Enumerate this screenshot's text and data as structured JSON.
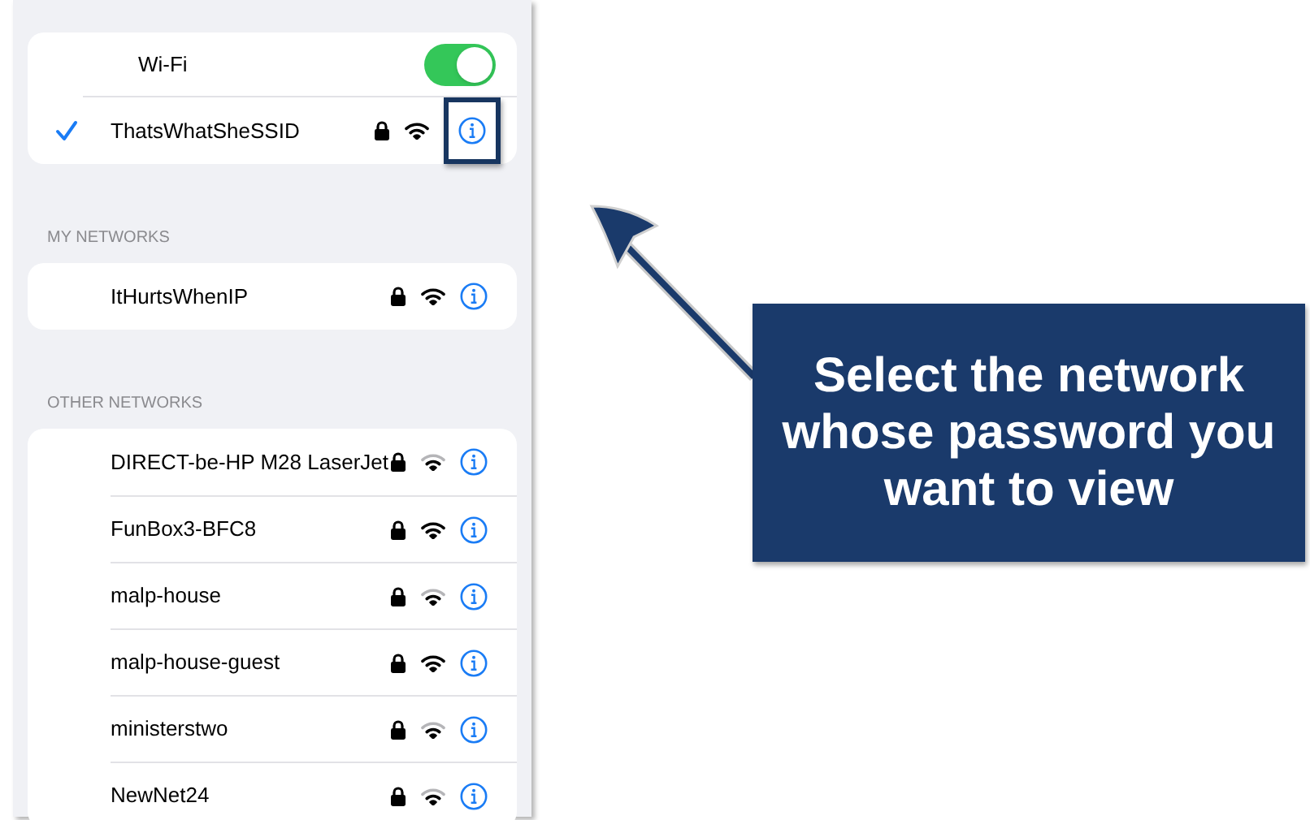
{
  "wifi": {
    "label": "Wi-Fi",
    "on": true
  },
  "connected": {
    "name": "ThatsWhatSheSSID",
    "selected": true,
    "locked": true,
    "weak_signal": false,
    "highlighted": true
  },
  "sections": [
    {
      "title": "MY NETWORKS",
      "networks": [
        {
          "name": "ItHurtsWhenIP",
          "locked": true,
          "weak_signal": false
        }
      ]
    },
    {
      "title": "OTHER NETWORKS",
      "networks": [
        {
          "name": "DIRECT-be-HP M28 LaserJet",
          "locked": true,
          "weak_signal": true
        },
        {
          "name": "FunBox3-BFC8",
          "locked": true,
          "weak_signal": false
        },
        {
          "name": "malp-house",
          "locked": true,
          "weak_signal": true
        },
        {
          "name": "malp-house-guest",
          "locked": true,
          "weak_signal": false
        },
        {
          "name": "ministerstwo",
          "locked": true,
          "weak_signal": true
        },
        {
          "name": "NewNet24",
          "locked": true,
          "weak_signal": true
        }
      ]
    }
  ],
  "callout": {
    "text": "Select the network whose password you want to view"
  }
}
